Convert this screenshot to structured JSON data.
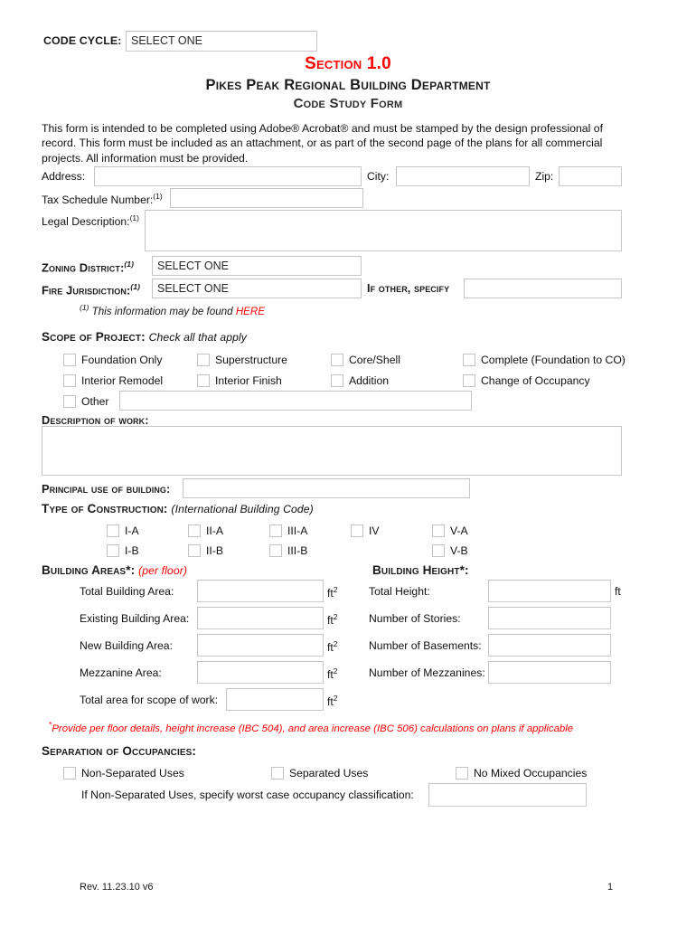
{
  "document": {
    "code_cycle_label": "CODE CYCLE:",
    "code_cycle_value": "SELECT ONE",
    "title_section": "Section 1.0",
    "title_department": "Pikes Peak Regional Building Department",
    "title_form": "Code Study Form",
    "intro_text": "This form is intended to be completed using Adobe® Acrobat® and must be stamped by the design professional of record.  This form must be included as an attachment, or as part of the second page of the plans for all commercial projects.  All information must be provided."
  },
  "location": {
    "address_label": "Address:",
    "address_value": "",
    "city_label": "City:",
    "city_value": "",
    "zip_label": "Zip:",
    "zip_value": "",
    "tax_schedule_label": "Tax Schedule Number:",
    "tax_schedule_sup": "(1)",
    "tax_schedule_value": "",
    "legal_description_label": "Legal Description:",
    "legal_description_sup": "(1)",
    "legal_description_value": ""
  },
  "jurisdiction": {
    "zoning_label": "Zoning District:",
    "zoning_sup": "(1)",
    "zoning_value": "SELECT ONE",
    "fire_label": "Fire Jurisdiction:",
    "fire_sup": "(1)",
    "fire_value": "SELECT ONE",
    "if_other_label": "If other, specify",
    "if_other_value": "",
    "footnote_sup": "(1)",
    "footnote_text": "This information may be found",
    "footnote_link": "HERE"
  },
  "scope": {
    "heading": "Scope of Project:",
    "heading_note": "Check all that apply",
    "options": [
      "Foundation Only",
      "Superstructure",
      "Core/Shell",
      "Complete (Foundation to CO)",
      "Interior Remodel",
      "Interior Finish",
      "Addition",
      "Change of Occupancy"
    ],
    "other_label": "Other",
    "other_value": ""
  },
  "description": {
    "heading": "Description of work:",
    "value": ""
  },
  "principal_use": {
    "label": "Principal use of building:",
    "value": ""
  },
  "construction": {
    "heading": "Type of Construction:",
    "heading_note": "(International Building Code)",
    "row1": [
      "I-A",
      "II-A",
      "III-A",
      "IV",
      "V-A"
    ],
    "row2": [
      "I-B",
      "II-B",
      "III-B",
      "V-B"
    ]
  },
  "areas": {
    "heading": "Building Areas*:",
    "heading_note": "(per floor)",
    "unit": "ft",
    "unit_sup": "2",
    "rows": [
      {
        "label": "Total Building Area:",
        "value": ""
      },
      {
        "label": "Existing Building Area:",
        "value": ""
      },
      {
        "label": "New Building Area:",
        "value": ""
      },
      {
        "label": "Mezzanine Area:",
        "value": ""
      },
      {
        "label": "Total area for scope of work:",
        "value": ""
      }
    ]
  },
  "height": {
    "heading": "Building Height*:",
    "unit": "ft",
    "rows": [
      {
        "label": "Total Height:",
        "value": "",
        "unit": "ft"
      },
      {
        "label": "Number of Stories:",
        "value": "",
        "unit": ""
      },
      {
        "label": "Number of Basements:",
        "value": "",
        "unit": ""
      },
      {
        "label": "Number of Mezzanines:",
        "value": "",
        "unit": ""
      }
    ]
  },
  "asterisk_note": {
    "mark": "*",
    "text": "Provide per floor details, height increase (IBC 504), and area increase (IBC 506) calculations on plans if applicable"
  },
  "separation": {
    "heading": "Separation of Occupancies:",
    "options": [
      "Non-Separated Uses",
      "Separated Uses",
      "No Mixed Occupancies"
    ],
    "specify_label": "If Non-Separated Uses, specify worst case occupancy classification:",
    "specify_value": ""
  },
  "footer": {
    "revision": "Rev. 11.23.10 v6",
    "page_number": "1"
  },
  "colors": {
    "accent_red": "#ff0000",
    "field_border": "#c3c3c3",
    "text": "#101010"
  }
}
